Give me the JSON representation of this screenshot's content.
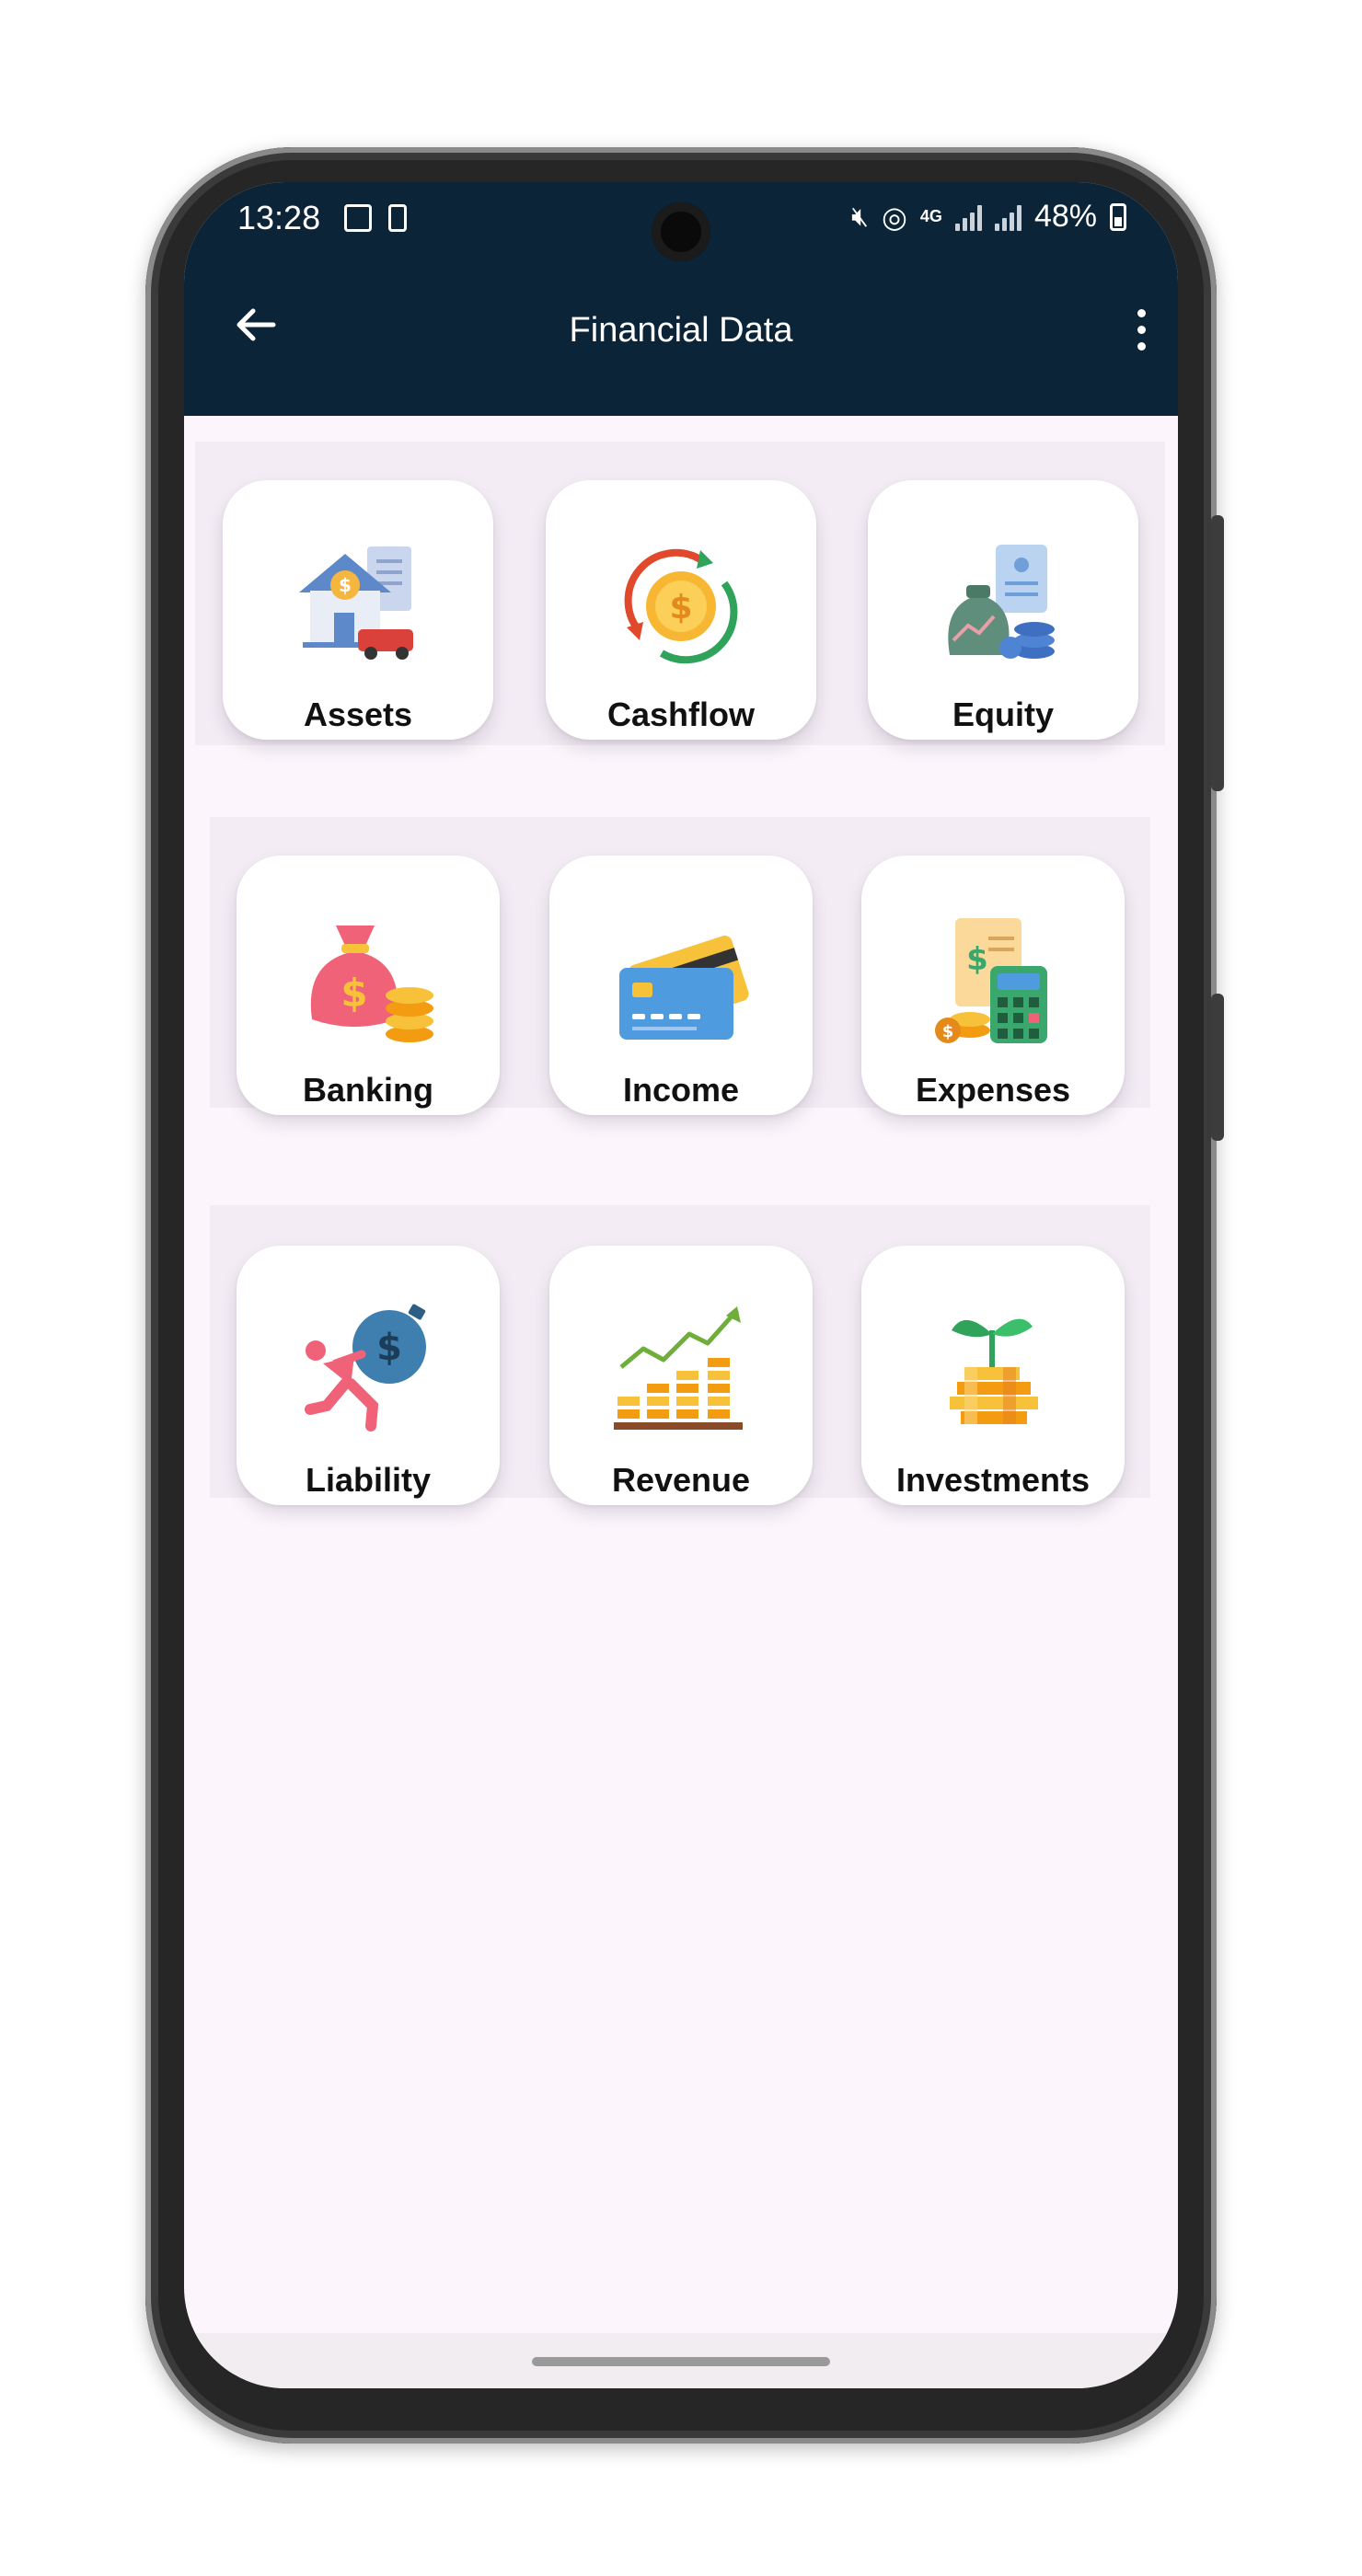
{
  "status_bar": {
    "time": "13:28",
    "network": "4G",
    "battery": "48%"
  },
  "app_bar": {
    "title": "Financial Data",
    "back_icon": "arrow-left-icon",
    "menu_icon": "more-vertical-icon"
  },
  "categories": [
    {
      "label": "Assets",
      "icon": "house-car-icon"
    },
    {
      "label": "Cashflow",
      "icon": "dollar-cycle-icon"
    },
    {
      "label": "Equity",
      "icon": "money-bag-document-icon"
    },
    {
      "label": "Banking",
      "icon": "money-bag-coins-icon"
    },
    {
      "label": "Income",
      "icon": "credit-cards-icon"
    },
    {
      "label": "Expenses",
      "icon": "bill-calculator-icon"
    },
    {
      "label": "Liability",
      "icon": "person-debt-ball-icon"
    },
    {
      "label": "Revenue",
      "icon": "coin-stacks-growth-icon"
    },
    {
      "label": "Investments",
      "icon": "plant-coins-icon"
    }
  ],
  "colors": {
    "app_bar": "#0c2438",
    "background": "#fcf6fc",
    "card": "#ffffff"
  }
}
